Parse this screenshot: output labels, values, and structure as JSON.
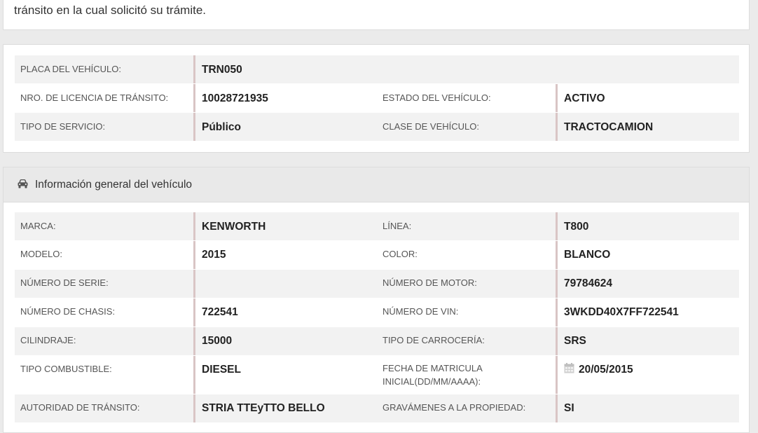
{
  "intro": {
    "text": "tránsito en la cual solicitó su trámite."
  },
  "plate_section": {
    "rows": [
      {
        "label1": "PLACA DEL VEHÍCULO:",
        "value1": "TRN050"
      },
      {
        "label1": "NRO. DE LICENCIA DE TRÁNSITO:",
        "value1": "10028721935",
        "label2": "ESTADO DEL VEHÍCULO:",
        "value2": "ACTIVO"
      },
      {
        "label1": "TIPO DE SERVICIO:",
        "value1": "Público",
        "label2": "CLASE DE VEHÍCULO:",
        "value2": "TRACTOCAMION"
      }
    ]
  },
  "vehicle_info": {
    "title": "Información general del vehículo",
    "icon": "car-icon",
    "rows": [
      {
        "label1": "MARCA:",
        "value1": "KENWORTH",
        "label2": "LÍNEA:",
        "value2": "T800"
      },
      {
        "label1": "MODELO:",
        "value1": "2015",
        "label2": "COLOR:",
        "value2": "BLANCO"
      },
      {
        "label1": "NÚMERO DE SERIE:",
        "value1": "",
        "label2": "NÚMERO DE MOTOR:",
        "value2": "79784624"
      },
      {
        "label1": "NÚMERO DE CHASIS:",
        "value1": "722541",
        "label2": "NÚMERO DE VIN:",
        "value2": "3WKDD40X7FF722541"
      },
      {
        "label1": "CILINDRAJE:",
        "value1": "15000",
        "label2": "TIPO DE CARROCERÍA:",
        "value2": "SRS"
      },
      {
        "label1": "TIPO COMBUSTIBLE:",
        "value1": "DIESEL",
        "label2_line1": "FECHA DE MATRICULA",
        "label2_line2": "INICIAL(DD/MM/AAAA):",
        "value2": "20/05/2015",
        "value2_icon": "calendar-icon"
      },
      {
        "label1": "AUTORIDAD DE TRÁNSITO:",
        "value1": "STRIA TTEyTTO BELLO",
        "label2": "GRAVÁMENES A LA PROPIEDAD:",
        "value2": "SI"
      }
    ]
  },
  "colors": {
    "row_shade": "#f2f2f2",
    "value_bar": "#d9c5c5",
    "header_bg": "#e9e9e9",
    "page_bg": "#ebebeb"
  }
}
